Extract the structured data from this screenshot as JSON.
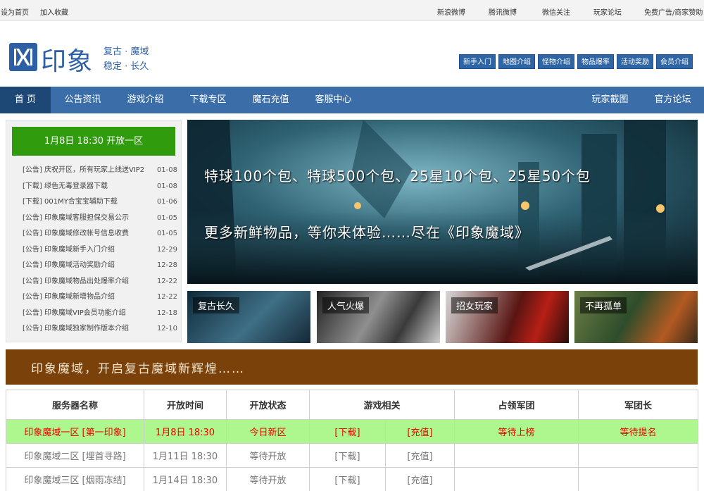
{
  "topbar": {
    "left": [
      "设为首页",
      "加入收藏"
    ],
    "right": [
      "新浪微博",
      "腾讯微博",
      "微信关注",
      "玩家论坛",
      "免费广告/商家赞助"
    ]
  },
  "header": {
    "logo_text": "印象",
    "slogan_top": "复古 · 魔域",
    "slogan_bottom": "稳定 · 长久",
    "quick_links": [
      "新手入门",
      "地图介绍",
      "怪物介绍",
      "物品爆率",
      "活动奖励",
      "会员介绍"
    ]
  },
  "nav": {
    "items": [
      "首 页",
      "公告资讯",
      "游戏介绍",
      "下载专区",
      "魔石充值",
      "客服中心"
    ],
    "right_items": [
      "玩家截图",
      "官方论坛"
    ]
  },
  "news": {
    "open_banner": "1月8日 18:30 开放一区",
    "items": [
      {
        "title": "[公告] 庆祝开区，所有玩家上线送VIP2",
        "date": "01-08"
      },
      {
        "title": "[下载] 绿色无毒登录器下载",
        "date": "01-08"
      },
      {
        "title": "[下载] 001MY合宝宝辅助下载",
        "date": "01-06"
      },
      {
        "title": "[公告] 印象魔域客服担保交易公示",
        "date": "01-05"
      },
      {
        "title": "[公告] 印象魔域修改帐号信息收费",
        "date": "01-05"
      },
      {
        "title": "[公告] 印象魔域新手入门介绍",
        "date": "12-29"
      },
      {
        "title": "[公告] 印象魔域活动奖励介绍",
        "date": "12-28"
      },
      {
        "title": "[公告] 印象魔域物品出处爆率介绍",
        "date": "12-22"
      },
      {
        "title": "[公告] 印象魔域新增物品介绍",
        "date": "12-22"
      },
      {
        "title": "[公告] 印象魔域VIP会员功能介绍",
        "date": "12-18"
      },
      {
        "title": "[公告] 印象魔域独家制作版本介绍",
        "date": "12-10"
      }
    ]
  },
  "hero": {
    "line1": "特球100个包、特球500个包、25星10个包、25星50个包",
    "line2": "更多新鲜物品，等你来体验……尽在《印象魔域》"
  },
  "thumbs": [
    "复古长久",
    "人气火爆",
    "招女玩家",
    "不再孤单"
  ],
  "slogan_bar": "印象魔域，开启复古魔域新辉煌……",
  "server_table": {
    "headers": [
      "服务器名称",
      "开放时间",
      "开放状态",
      "游戏相关",
      "占领军团",
      "军团长"
    ],
    "rows": [
      {
        "name": "印象魔域一区 [第一印象]",
        "time": "1月8日 18:30",
        "status": "今日新区",
        "download": "[下载]",
        "recharge": "[充值]",
        "legion": "等待上榜",
        "leader": "等待提名"
      },
      {
        "name": "印象魔域二区 [埋首寻路]",
        "time": "1月11日 18:30",
        "status": "等待开放",
        "download": "[下载]",
        "recharge": "[充值]",
        "legion": "",
        "leader": ""
      },
      {
        "name": "印象魔域三区 [烟雨冻结]",
        "time": "1月14日 18:30",
        "status": "等待开放",
        "download": "[下载]",
        "recharge": "[充值]",
        "legion": "",
        "leader": ""
      }
    ]
  },
  "colors": {
    "brand_blue": "#2c5fa3",
    "nav_blue": "#3b6ea8",
    "nav_active": "#1d4876",
    "open_green": "#2f9b0d",
    "slogan_brown": "#7b410a",
    "hot_row": "#aef78e",
    "hot_text": "#e00000"
  }
}
